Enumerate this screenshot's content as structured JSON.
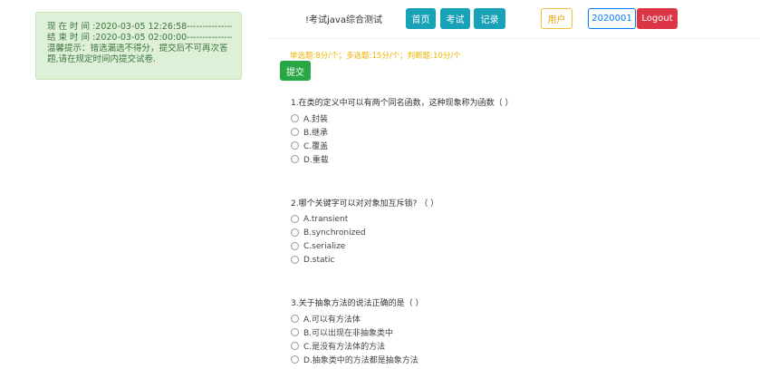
{
  "timer": {
    "current_time": "现 在 时 间 :2020-03-05 12:26:58-----------------",
    "end_time": "结 束 时 间 :2020-03-05 02:00:00-----------------",
    "notice": "温馨提示：错选漏选不得分，提交后不可再次答题,请在规定时间内提交试卷."
  },
  "header": {
    "exam_title": "!考试java综合测试",
    "nav": {
      "home": "首页",
      "exam": "考试",
      "records": "记录"
    },
    "user_label": "用户",
    "user_id": "2020001",
    "logout": "Logout"
  },
  "scoring_info": "单选题:8分/个；多选题:15分/个；判断题:10分/个",
  "submit_label": "提交",
  "questions": [
    {
      "text": "1.在类的定义中可以有两个同名函数，这种现象称为函数（ ）",
      "options": [
        "A.封装",
        "B.继承",
        "C.覆盖",
        "D.重载"
      ]
    },
    {
      "text": "2.哪个关键字可以对对象加互斥锁? （ ）",
      "options": [
        "A.transient",
        "B.synchronized",
        "C.serialize",
        "D.static"
      ]
    },
    {
      "text": "3.关于抽象方法的说法正确的是（ ）",
      "options": [
        "A.可以有方法体",
        "B.可以出现在非抽象类中",
        "C.是没有方法体的方法",
        "D.抽象类中的方法都是抽象方法"
      ]
    }
  ]
}
